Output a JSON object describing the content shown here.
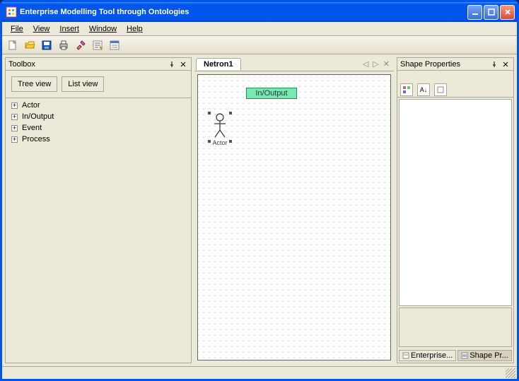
{
  "titlebar": {
    "title": "Enterprise Modelling Tool through Ontologies"
  },
  "menu": {
    "file": "File",
    "view": "View",
    "insert": "Insert",
    "window": "Window",
    "help": "Help"
  },
  "toolbox": {
    "title": "Toolbox",
    "btn_tree": "Tree view",
    "btn_list": "List view",
    "items": [
      "Actor",
      "In/Output",
      "Event",
      "Process"
    ]
  },
  "canvas": {
    "tab": "Netron1",
    "shapes": {
      "io_label": "In/Output",
      "actor_label": "Actor"
    }
  },
  "props": {
    "title": "Shape Properties",
    "tabs": {
      "enterprise": "Enterprise...",
      "shape": "Shape Pr..."
    }
  }
}
